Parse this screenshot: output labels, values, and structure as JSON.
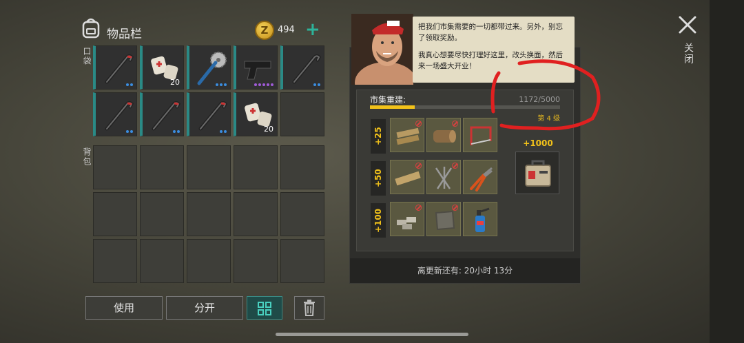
{
  "inventory": {
    "title": "物品栏",
    "coins": "494",
    "coin_symbol": "Z",
    "pocket_label": "口袋",
    "backpack_label": "背包",
    "pocket_slots": [
      {
        "item": "crowbar-icon",
        "dots": 2
      },
      {
        "item": "bandage-icon",
        "qty": "20"
      },
      {
        "item": "saw-axe-icon",
        "dots": 3
      },
      {
        "item": "pistol-icon",
        "dots": 5,
        "dot_color": "purple"
      },
      {
        "item": "crowbar-icon",
        "dots": 2
      },
      {
        "item": "crowbar-icon",
        "dots": 2
      },
      {
        "item": "crowbar-icon",
        "dots": 2
      },
      {
        "item": "crowbar-icon",
        "dots": 2
      },
      {
        "item": "bandage-icon",
        "qty": "20"
      },
      {
        "item": ""
      }
    ]
  },
  "buttons": {
    "use": "使用",
    "split": "分开"
  },
  "npc": {
    "line1": "把我们市集需要的一切都带过来。另外，别忘了领取奖励。",
    "line2": "我真心想要尽快打理好这里，改头换面，然后来一场盛大开业！"
  },
  "market": {
    "title": "市集重建:",
    "progress_text": "1172/5000",
    "progress": 0.2344,
    "level": "第 4 级",
    "tiers": [
      {
        "label": "+25",
        "items": [
          "planks-icon",
          "log-icon",
          "hacksaw-icon"
        ]
      },
      {
        "label": "+50",
        "items": [
          "board-icon",
          "nails-icon",
          "pliers-icon"
        ]
      },
      {
        "label": "+100",
        "items": [
          "metal-bars-icon",
          "stone-icon",
          "blowtorch-icon"
        ]
      }
    ],
    "reward_label": "+1000",
    "reward_item": "toolbox-icon",
    "footer": "离更新还有:  20小时 13分"
  },
  "close": {
    "label": "关闭"
  },
  "colors": {
    "accent_teal": "#2a8a86",
    "accent_yellow": "#f2c21a",
    "annotation_red": "#e02020"
  }
}
